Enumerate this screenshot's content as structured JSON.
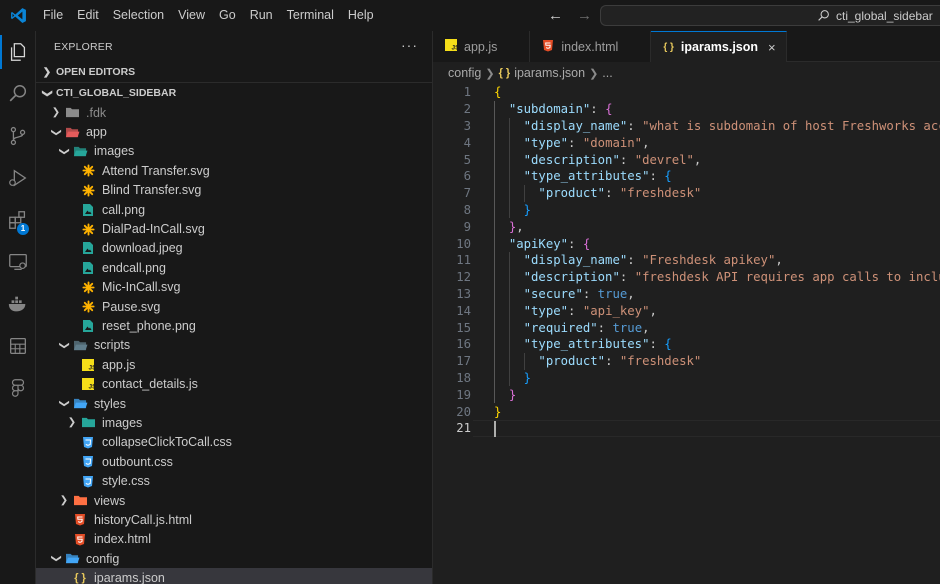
{
  "menu": [
    "File",
    "Edit",
    "Selection",
    "View",
    "Go",
    "Run",
    "Terminal",
    "Help"
  ],
  "search": {
    "text": "cti_global_sidebar"
  },
  "activity_bar": {
    "extensions_badge": "1"
  },
  "sidebar": {
    "title": "EXPLORER",
    "more": "···",
    "open_editors": "OPEN EDITORS",
    "project": "CTI_GLOBAL_SIDEBAR",
    "tree": [
      {
        "label": ".fdk",
        "depth": 1,
        "kind": "folder-closed",
        "icon": "folder-icon",
        "color": "#8b8b8b",
        "dim": true
      },
      {
        "label": "app",
        "depth": 1,
        "kind": "folder-open",
        "icon": "folder-app-icon",
        "color": "#e45b5b"
      },
      {
        "label": "images",
        "depth": 2,
        "kind": "folder-open",
        "icon": "folder-images-icon",
        "color": "#26a69a"
      },
      {
        "label": "Attend Transfer.svg",
        "depth": 3,
        "kind": "file",
        "icon": "svg-file-icon",
        "color": "#ffb300"
      },
      {
        "label": "Blind Transfer.svg",
        "depth": 3,
        "kind": "file",
        "icon": "svg-file-icon",
        "color": "#ffb300"
      },
      {
        "label": "call.png",
        "depth": 3,
        "kind": "file",
        "icon": "image-file-icon",
        "color": "#26a69a"
      },
      {
        "label": "DialPad-InCall.svg",
        "depth": 3,
        "kind": "file",
        "icon": "svg-file-icon",
        "color": "#ffb300"
      },
      {
        "label": "download.jpeg",
        "depth": 3,
        "kind": "file",
        "icon": "image-file-icon",
        "color": "#26a69a"
      },
      {
        "label": "endcall.png",
        "depth": 3,
        "kind": "file",
        "icon": "image-file-icon",
        "color": "#26a69a"
      },
      {
        "label": "Mic-InCall.svg",
        "depth": 3,
        "kind": "file",
        "icon": "svg-file-icon",
        "color": "#ffb300"
      },
      {
        "label": "Pause.svg",
        "depth": 3,
        "kind": "file",
        "icon": "svg-file-icon",
        "color": "#ffb300"
      },
      {
        "label": "reset_phone.png",
        "depth": 3,
        "kind": "file",
        "icon": "image-file-icon",
        "color": "#26a69a"
      },
      {
        "label": "scripts",
        "depth": 2,
        "kind": "folder-open",
        "icon": "folder-scripts-icon",
        "color": "#607d8b"
      },
      {
        "label": "app.js",
        "depth": 3,
        "kind": "file",
        "icon": "js-file-icon",
        "color": "#f5de19"
      },
      {
        "label": "contact_details.js",
        "depth": 3,
        "kind": "file",
        "icon": "js-file-icon",
        "color": "#f5de19"
      },
      {
        "label": "styles",
        "depth": 2,
        "kind": "folder-open",
        "icon": "folder-styles-icon",
        "color": "#42a5f5"
      },
      {
        "label": "images",
        "depth": 3,
        "kind": "folder-closed",
        "icon": "folder-images-icon",
        "color": "#26a69a"
      },
      {
        "label": "collapseClickToCall.css",
        "depth": 3,
        "kind": "file",
        "icon": "css-file-icon",
        "color": "#42a5f5"
      },
      {
        "label": "outbount.css",
        "depth": 3,
        "kind": "file",
        "icon": "css-file-icon",
        "color": "#42a5f5"
      },
      {
        "label": "style.css",
        "depth": 3,
        "kind": "file",
        "icon": "css-file-icon",
        "color": "#42a5f5"
      },
      {
        "label": "views",
        "depth": 2,
        "kind": "folder-closed",
        "icon": "folder-views-icon",
        "color": "#ff7043"
      },
      {
        "label": "historyCall.js.html",
        "depth": 2,
        "kind": "file",
        "icon": "html-file-icon",
        "color": "#e44d26"
      },
      {
        "label": "index.html",
        "depth": 2,
        "kind": "file",
        "icon": "html-file-icon",
        "color": "#e44d26"
      },
      {
        "label": "config",
        "depth": 1,
        "kind": "folder-open",
        "icon": "folder-config-icon",
        "color": "#42a5f5"
      },
      {
        "label": "iparams.json",
        "depth": 2,
        "kind": "file",
        "icon": "json-file-icon",
        "color": "#e8c95c",
        "selected": true
      }
    ]
  },
  "tabs": [
    {
      "label": "app.js",
      "icon": "js-file-icon",
      "glyph": "JS",
      "color": "#f5de19"
    },
    {
      "label": "index.html",
      "icon": "html-file-icon",
      "glyph": "5",
      "color": "#e44d26"
    },
    {
      "label": "iparams.json",
      "icon": "json-file-icon",
      "glyph": "{ }",
      "color": "#e8c95c",
      "active": true
    }
  ],
  "tab_close": "×",
  "breadcrumb": {
    "folder": "config",
    "file_icon": "{ }",
    "file": "iparams.json",
    "more": "..."
  },
  "editor": {
    "current_line": 21,
    "lines": [
      [
        [
          "p1",
          "{"
        ]
      ],
      [
        [
          "",
          "  "
        ],
        [
          "k",
          "\"subdomain\""
        ],
        [
          "",
          ": "
        ],
        [
          "p2",
          "{"
        ]
      ],
      [
        [
          "",
          "    "
        ],
        [
          "k",
          "\"display_name\""
        ],
        [
          "",
          ": "
        ],
        [
          "s",
          "\"what is subdomain of host Freshworks account\""
        ]
      ],
      [
        [
          "",
          "    "
        ],
        [
          "k",
          "\"type\""
        ],
        [
          "",
          ": "
        ],
        [
          "s",
          "\"domain\""
        ],
        [
          "",
          ","
        ]
      ],
      [
        [
          "",
          "    "
        ],
        [
          "k",
          "\"description\""
        ],
        [
          "",
          ": "
        ],
        [
          "s",
          "\"devrel\""
        ],
        [
          "",
          ","
        ]
      ],
      [
        [
          "",
          "    "
        ],
        [
          "k",
          "\"type_attributes\""
        ],
        [
          "",
          ": "
        ],
        [
          "p3",
          "{"
        ]
      ],
      [
        [
          "",
          "      "
        ],
        [
          "k",
          "\"product\""
        ],
        [
          "",
          ": "
        ],
        [
          "s",
          "\"freshdesk\""
        ]
      ],
      [
        [
          "",
          "    "
        ],
        [
          "p3",
          "}"
        ]
      ],
      [
        [
          "",
          "  "
        ],
        [
          "p2",
          "}"
        ],
        [
          "",
          ","
        ]
      ],
      [
        [
          "",
          "  "
        ],
        [
          "k",
          "\"apiKey\""
        ],
        [
          "",
          ": "
        ],
        [
          "p2",
          "{"
        ]
      ],
      [
        [
          "",
          "    "
        ],
        [
          "k",
          "\"display_name\""
        ],
        [
          "",
          ": "
        ],
        [
          "s",
          "\"Freshdesk apikey\""
        ],
        [
          "",
          ","
        ]
      ],
      [
        [
          "",
          "    "
        ],
        [
          "k",
          "\"description\""
        ],
        [
          "",
          ": "
        ],
        [
          "s",
          "\"freshdesk API requires app calls to include API"
        ]
      ],
      [
        [
          "",
          "    "
        ],
        [
          "k",
          "\"secure\""
        ],
        [
          "",
          ": "
        ],
        [
          "b",
          "true"
        ],
        [
          "",
          ","
        ]
      ],
      [
        [
          "",
          "    "
        ],
        [
          "k",
          "\"type\""
        ],
        [
          "",
          ": "
        ],
        [
          "s",
          "\"api_key\""
        ],
        [
          "",
          ","
        ]
      ],
      [
        [
          "",
          "    "
        ],
        [
          "k",
          "\"required\""
        ],
        [
          "",
          ": "
        ],
        [
          "b",
          "true"
        ],
        [
          "",
          ","
        ]
      ],
      [
        [
          "",
          "    "
        ],
        [
          "k",
          "\"type_attributes\""
        ],
        [
          "",
          ": "
        ],
        [
          "p3",
          "{"
        ]
      ],
      [
        [
          "",
          "      "
        ],
        [
          "k",
          "\"product\""
        ],
        [
          "",
          ": "
        ],
        [
          "s",
          "\"freshdesk\""
        ]
      ],
      [
        [
          "",
          "    "
        ],
        [
          "p3",
          "}"
        ]
      ],
      [
        [
          "",
          "  "
        ],
        [
          "p2",
          "}"
        ]
      ],
      [
        [
          "p1",
          "}"
        ]
      ],
      [
        [
          "",
          ""
        ]
      ]
    ]
  }
}
